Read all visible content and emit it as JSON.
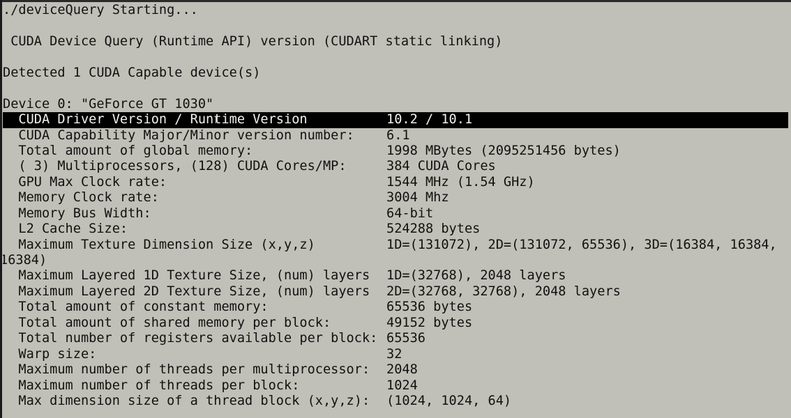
{
  "terminal": {
    "intro": [
      "./deviceQuery Starting...",
      "",
      " CUDA Device Query (Runtime API) version (CUDART static linking)",
      "",
      "Detected 1 CUDA Capable device(s)",
      "",
      "Device 0: \"GeForce GT 1030\""
    ],
    "properties": [
      {
        "key": "  CUDA Driver Version / Runtime Version",
        "value": "10.2 / 10.1",
        "selected": true
      },
      {
        "key": "  CUDA Capability Major/Minor version number:",
        "value": "6.1"
      },
      {
        "key": "  Total amount of global memory:",
        "value": "1998 MBytes (2095251456 bytes)"
      },
      {
        "key": "  ( 3) Multiprocessors, (128) CUDA Cores/MP:",
        "value": "384 CUDA Cores"
      },
      {
        "key": "  GPU Max Clock rate:",
        "value": "1544 MHz (1.54 GHz)"
      },
      {
        "key": "  Memory Clock rate:",
        "value": "3004 Mhz"
      },
      {
        "key": "  Memory Bus Width:",
        "value": "64-bit"
      },
      {
        "key": "  L2 Cache Size:",
        "value": "524288 bytes"
      },
      {
        "key": "  Maximum Texture Dimension Size (x,y,z)",
        "value": "1D=(131072), 2D=(131072, 65536), 3D=(16384, 16384,"
      },
      {
        "key": "",
        "value": "16384)",
        "wrap": true
      },
      {
        "key": "  Maximum Layered 1D Texture Size, (num) layers",
        "value": "1D=(32768), 2048 layers"
      },
      {
        "key": "  Maximum Layered 2D Texture Size, (num) layers",
        "value": "2D=(32768, 32768), 2048 layers"
      },
      {
        "key": "  Total amount of constant memory:",
        "value": "65536 bytes"
      },
      {
        "key": "  Total amount of shared memory per block:",
        "value": "49152 bytes"
      },
      {
        "key": "  Total number of registers available per block:",
        "value": "65536"
      },
      {
        "key": "  Warp size:",
        "value": "32"
      },
      {
        "key": "  Maximum number of threads per multiprocessor:",
        "value": "2048"
      },
      {
        "key": "  Maximum number of threads per block:",
        "value": "1024"
      },
      {
        "key": "  Max dimension size of a thread block (x,y,z):",
        "value": "(1024, 1024, 64)"
      }
    ]
  }
}
